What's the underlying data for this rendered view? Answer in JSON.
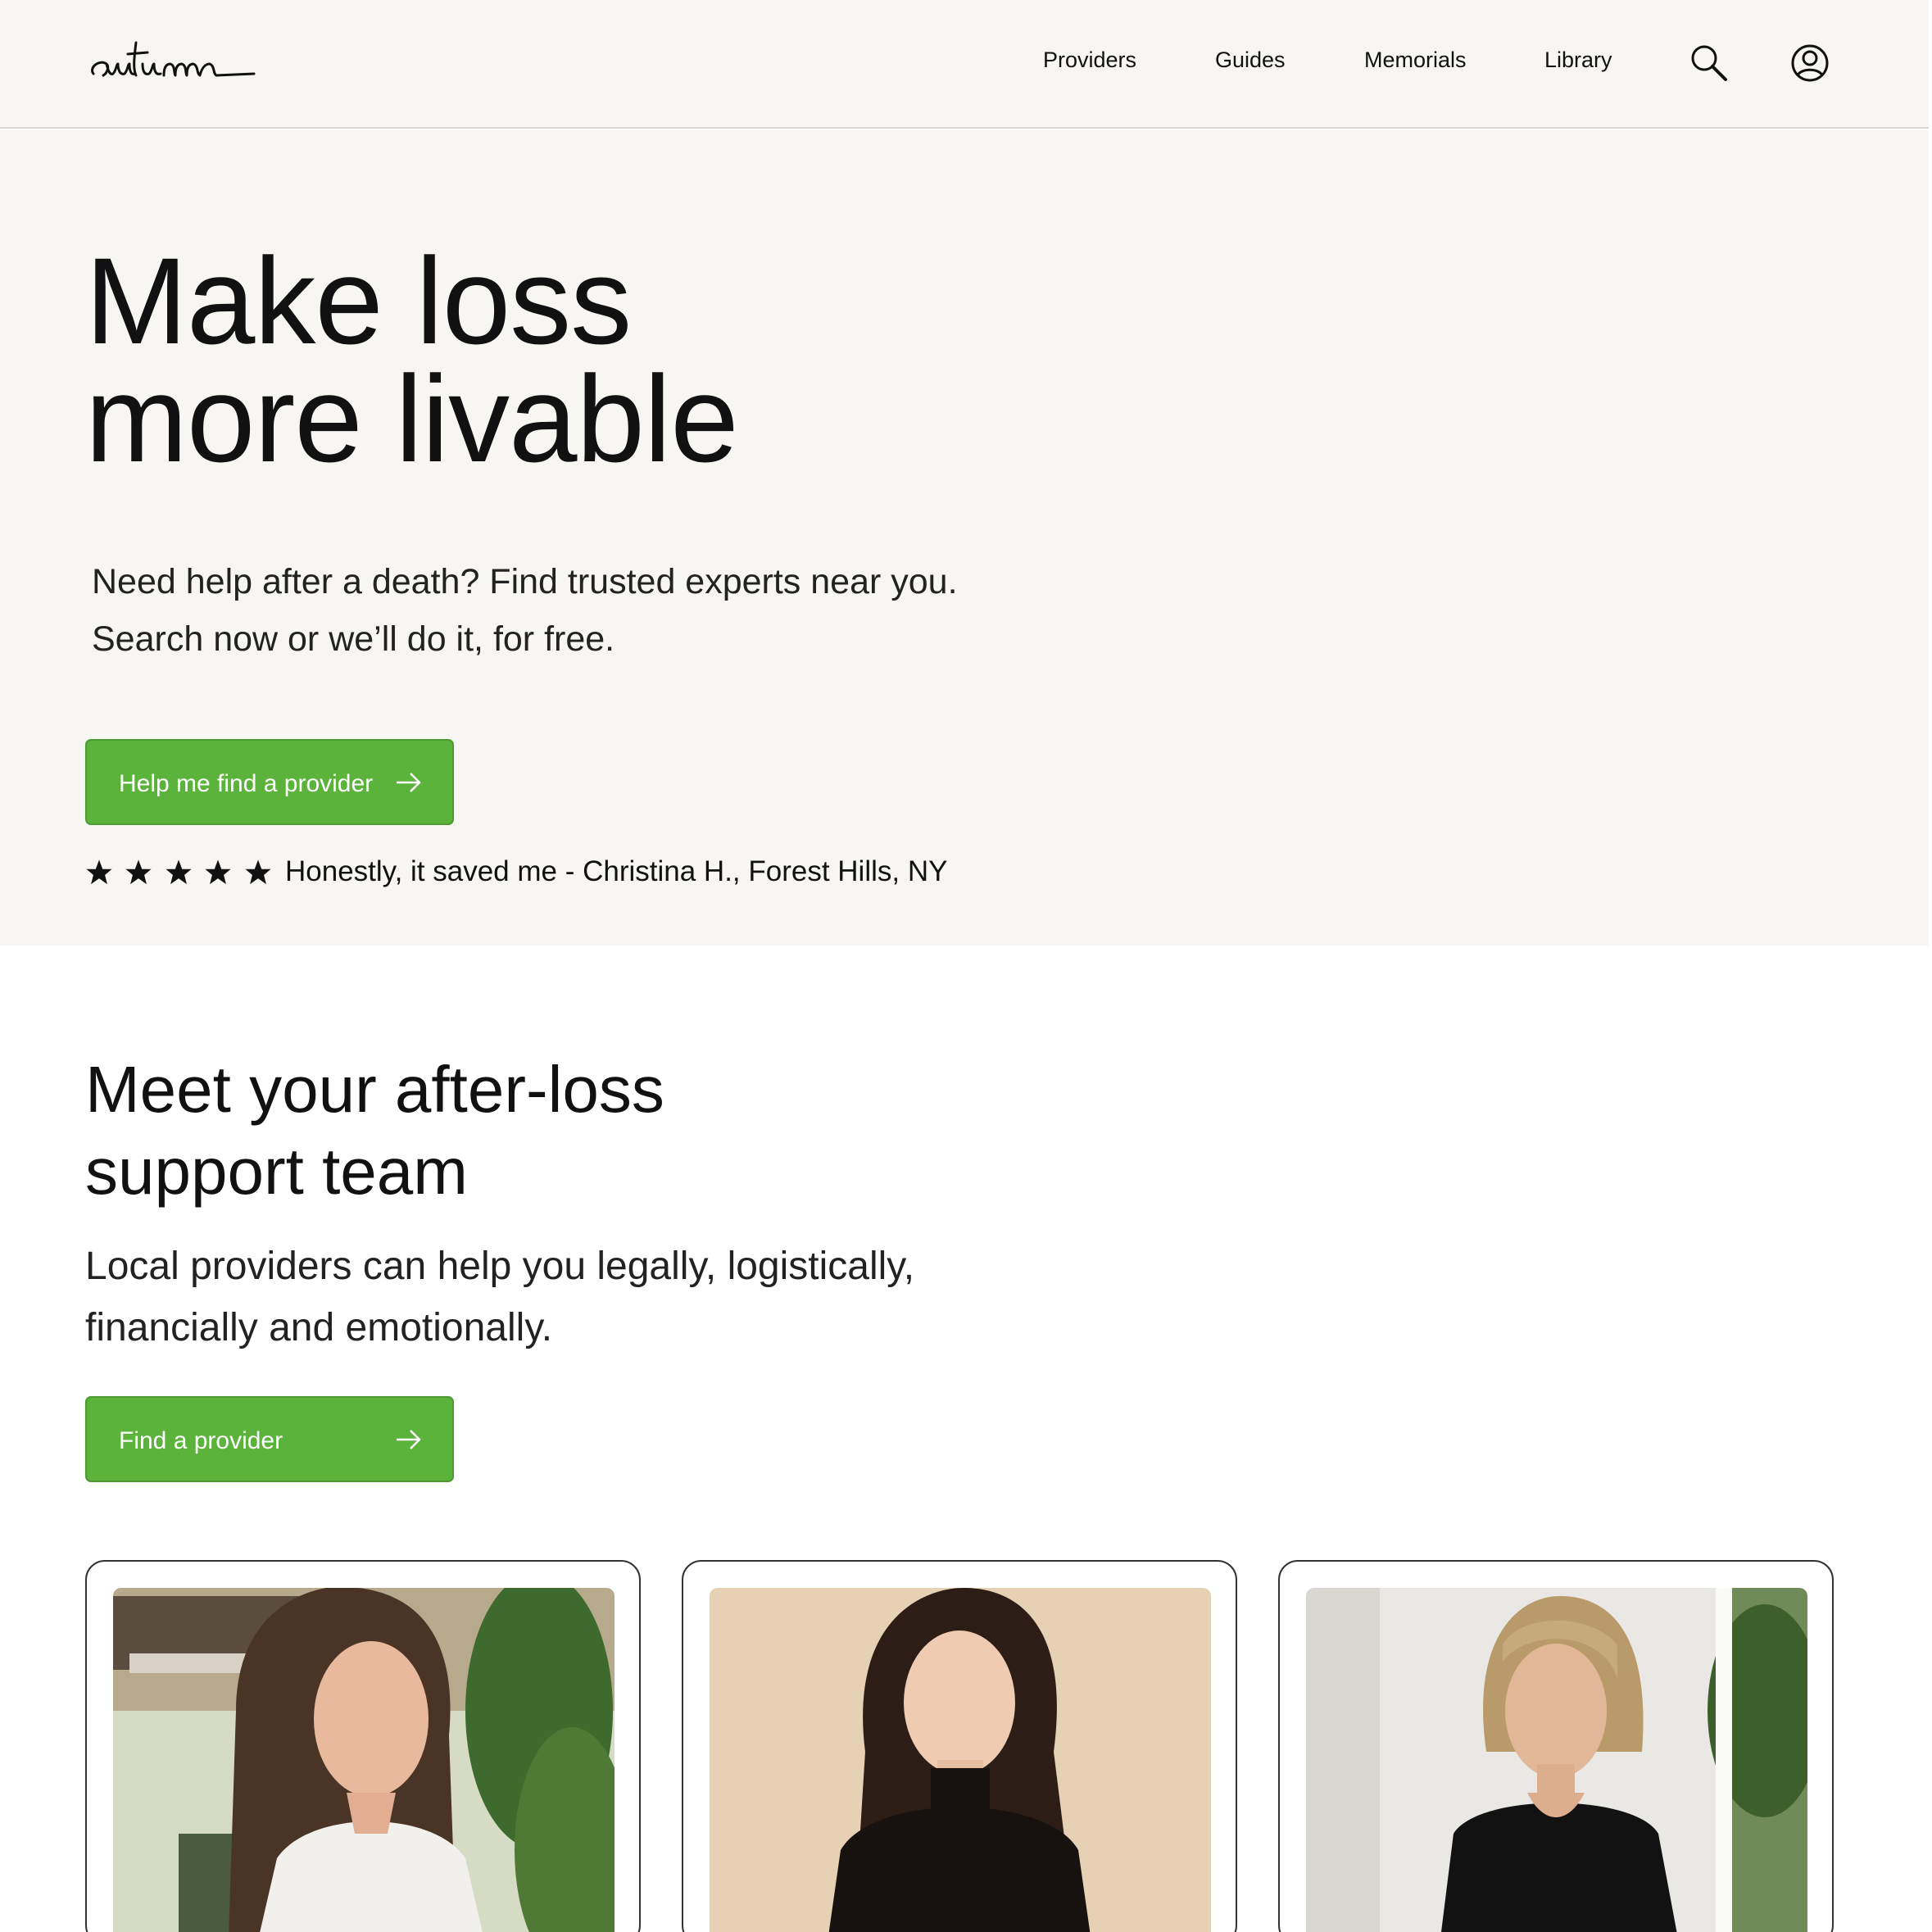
{
  "header": {
    "logo_text": "autumn",
    "nav": [
      "Providers",
      "Guides",
      "Memorials",
      "Library"
    ]
  },
  "hero": {
    "title_line1": "Make loss",
    "title_line2": "more livable",
    "subtitle_line1": "Need help after a death? Find trusted experts near you.",
    "subtitle_line2": "Search now or we’ll do it, for free.",
    "cta_label": "Help me find a provider",
    "rating": 5,
    "review": "Honestly, it saved me - Christina H., Forest Hills, NY"
  },
  "team": {
    "title_line1": "Meet your after-loss",
    "title_line2": "support team",
    "subtitle_line1": "Local providers can help you legally, logistically,",
    "subtitle_line2": "financially and emotionally.",
    "cta_label": "Find a provider"
  },
  "colors": {
    "accent": "#5bb33b",
    "cream": "#f7f6f2"
  }
}
